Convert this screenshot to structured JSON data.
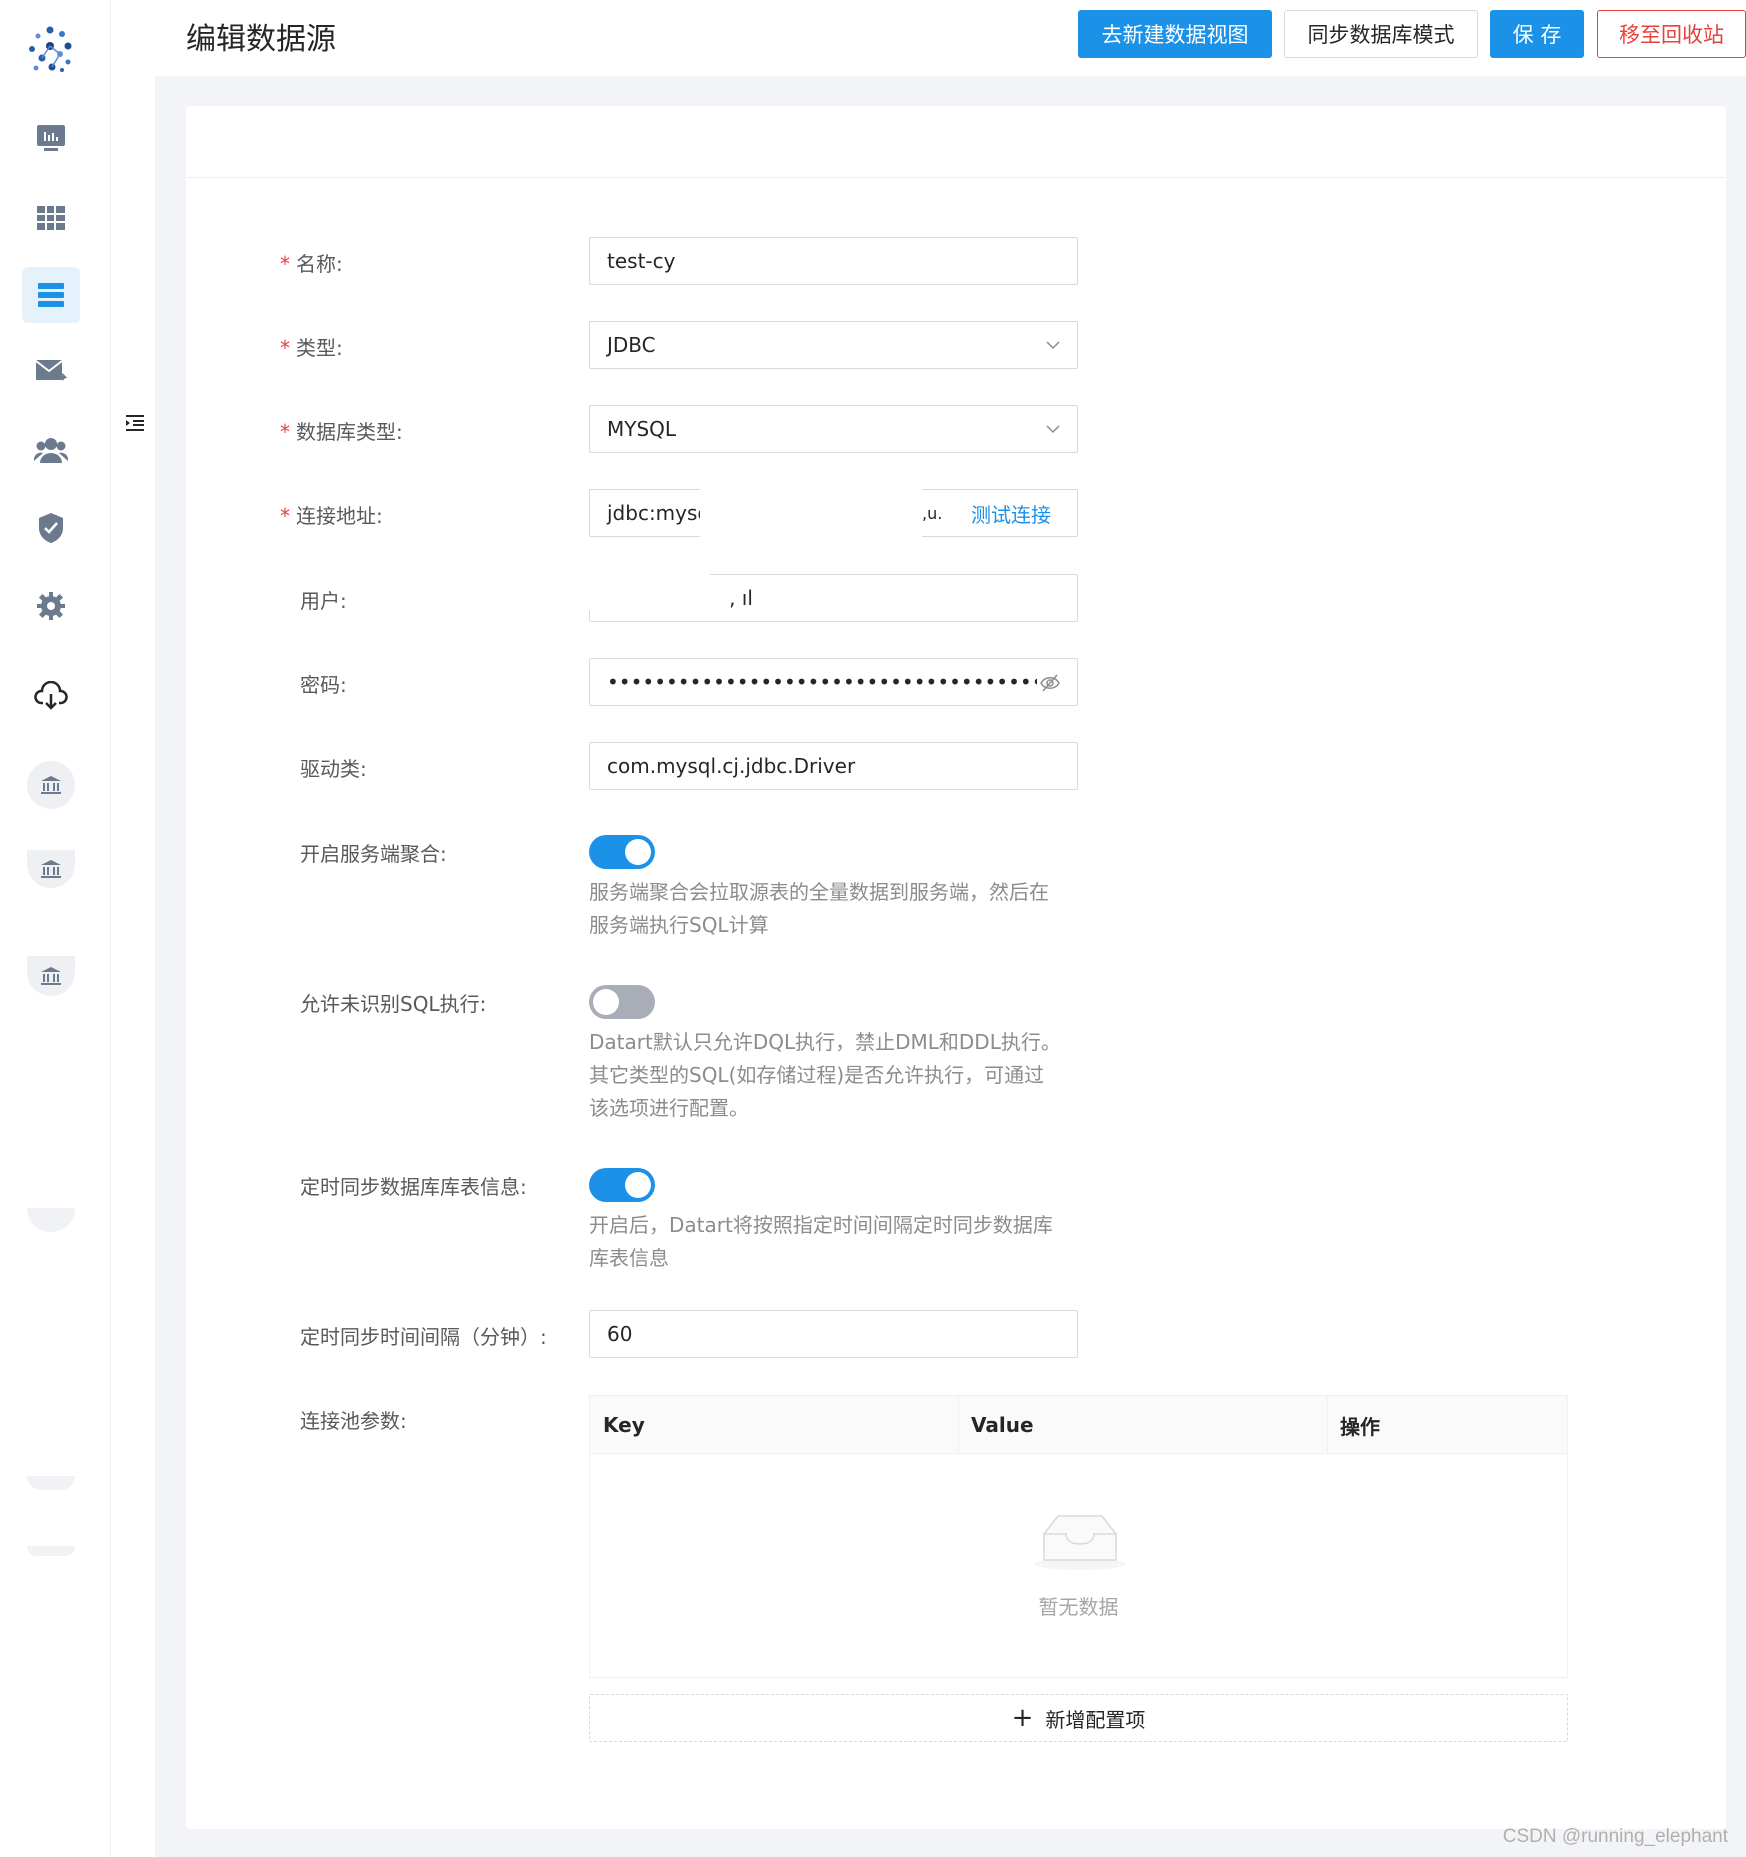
{
  "header": {
    "title": "编辑数据源",
    "buttons": {
      "new_view": "去新建数据视图",
      "sync_schema": "同步数据库模式",
      "save": "保 存",
      "recycle": "移至回收站"
    }
  },
  "form": {
    "name": {
      "label": "名称:",
      "value": "test-cy",
      "required": true
    },
    "type": {
      "label": "类型:",
      "value": "JDBC",
      "required": true
    },
    "db_type": {
      "label": "数据库类型:",
      "value": "MYSQL",
      "required": true
    },
    "url": {
      "label": "连接地址:",
      "value": "jdbc:mysq",
      "value_tail": ",u.",
      "test_link": "测试连接",
      "required": true
    },
    "user": {
      "label": "用户:",
      "value": "   , ıl"
    },
    "password": {
      "label": "密码:",
      "value": "••••••••••••••••••••••••••••••••••••••••••••••••••"
    },
    "driver": {
      "label": "驱动类:",
      "value": "com.mysql.cj.jdbc.Driver"
    },
    "server_aggregate": {
      "label": "开启服务端聚合:",
      "enabled": true,
      "help_1": "服务端聚合会拉取源表的全量数据到服务端，然后在",
      "help_2": "服务端执行SQL计算"
    },
    "allow_unknown_sql": {
      "label": "允许未识别SQL执行:",
      "enabled": false,
      "help_1": "Datart默认只允许DQL执行，禁止DML和DDL执行。",
      "help_2": "其它类型的SQL(如存储过程)是否允许执行，可通过",
      "help_3": "该选项进行配置。"
    },
    "scheduled_sync": {
      "label": "定时同步数据库库表信息:",
      "enabled": true,
      "help_1": "开启后，Datart将按照指定时间间隔定时同步数据库",
      "help_2": "库表信息"
    },
    "sync_interval": {
      "label": "定时同步时间间隔（分钟）:",
      "value": "60"
    },
    "pool_params": {
      "label": "连接池参数:",
      "columns": [
        "Key",
        "Value",
        "操作"
      ],
      "empty_text": "暂无数据",
      "add_label": "新增配置项"
    }
  },
  "sidebar": {
    "items": [
      "logo-icon",
      "dashboard-icon",
      "table-icon",
      "list-icon",
      "mail-icon",
      "users-icon",
      "shield-icon",
      "gear-icon",
      "cloud-download-icon",
      "bank-icon",
      "bank-icon",
      "bank-icon"
    ],
    "active_index": 3
  },
  "colors": {
    "primary": "#1b91e8",
    "danger": "#e8403a",
    "icon": "#6b7a8c"
  },
  "watermark": "CSDN @running_elephant"
}
